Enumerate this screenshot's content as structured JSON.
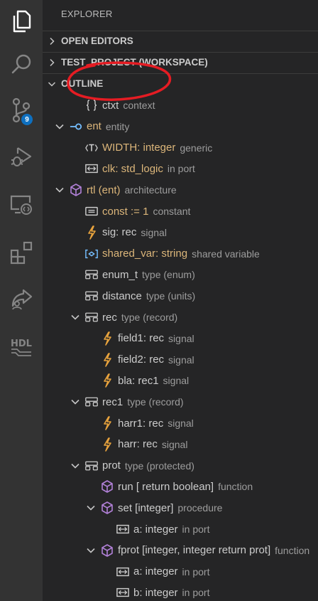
{
  "sidebar": {
    "title": "EXPLORER",
    "sections": [
      {
        "label": "OPEN EDITORS",
        "expanded": false
      },
      {
        "label": "TEST_PROJECT (WORKSPACE)",
        "expanded": false
      },
      {
        "label": "OUTLINE",
        "expanded": true
      }
    ]
  },
  "activity_bar": {
    "items": [
      {
        "icon": "files-icon"
      },
      {
        "icon": "search-icon"
      },
      {
        "icon": "source-control-icon",
        "badge": "9"
      },
      {
        "icon": "run-debug-icon"
      },
      {
        "icon": "remote-explorer-icon"
      },
      {
        "icon": "extensions-icon"
      },
      {
        "icon": "live-share-icon"
      },
      {
        "icon": "hdl-icon",
        "text": "HDL"
      }
    ]
  },
  "outline": [
    {
      "label": "ctxt",
      "desc": "context",
      "icon": "braces-icon",
      "depth": 1,
      "twisty": "none",
      "color": "normal"
    },
    {
      "label": "ent",
      "desc": "entity",
      "icon": "entity-icon",
      "depth": 0,
      "twisty": "open",
      "color": "yellow"
    },
    {
      "label": "WIDTH: integer",
      "desc": "generic",
      "icon": "type-param-icon",
      "depth": 1,
      "twisty": "none",
      "color": "yellow"
    },
    {
      "label": "clk: std_logic",
      "desc": "in port",
      "icon": "port-icon",
      "depth": 1,
      "twisty": "none",
      "color": "yellow"
    },
    {
      "label": "rtl (ent)",
      "desc": "architecture",
      "icon": "cube-icon",
      "depth": 0,
      "twisty": "open",
      "color": "yellow"
    },
    {
      "label": "const := 1",
      "desc": "constant",
      "icon": "constant-icon",
      "depth": 1,
      "twisty": "none",
      "color": "yellow"
    },
    {
      "label": "sig: rec",
      "desc": "signal",
      "icon": "signal-icon",
      "depth": 1,
      "twisty": "none",
      "color": "normal"
    },
    {
      "label": "shared_var: string",
      "desc": "shared variable",
      "icon": "variable-icon",
      "depth": 1,
      "twisty": "none",
      "color": "yellow"
    },
    {
      "label": "enum_t",
      "desc": "type (enum)",
      "icon": "struct-icon",
      "depth": 1,
      "twisty": "none",
      "color": "normal"
    },
    {
      "label": "distance",
      "desc": "type (units)",
      "icon": "struct-icon",
      "depth": 1,
      "twisty": "none",
      "color": "normal"
    },
    {
      "label": "rec",
      "desc": "type (record)",
      "icon": "struct-icon",
      "depth": 1,
      "twisty": "open",
      "color": "normal"
    },
    {
      "label": "field1: rec",
      "desc": "signal",
      "icon": "signal-icon",
      "depth": 2,
      "twisty": "none",
      "color": "normal"
    },
    {
      "label": "field2: rec",
      "desc": "signal",
      "icon": "signal-icon",
      "depth": 2,
      "twisty": "none",
      "color": "normal"
    },
    {
      "label": "bla: rec1",
      "desc": "signal",
      "icon": "signal-icon",
      "depth": 2,
      "twisty": "none",
      "color": "normal"
    },
    {
      "label": "rec1",
      "desc": "type (record)",
      "icon": "struct-icon",
      "depth": 1,
      "twisty": "open",
      "color": "normal"
    },
    {
      "label": "harr1: rec",
      "desc": "signal",
      "icon": "signal-icon",
      "depth": 2,
      "twisty": "none",
      "color": "normal"
    },
    {
      "label": "harr: rec",
      "desc": "signal",
      "icon": "signal-icon",
      "depth": 2,
      "twisty": "none",
      "color": "normal"
    },
    {
      "label": "prot",
      "desc": "type (protected)",
      "icon": "struct-icon",
      "depth": 1,
      "twisty": "open",
      "color": "normal"
    },
    {
      "label": "run [ return boolean]",
      "desc": "function",
      "icon": "method-icon",
      "depth": 2,
      "twisty": "none",
      "color": "normal"
    },
    {
      "label": "set [integer]",
      "desc": "procedure",
      "icon": "method-icon",
      "depth": 2,
      "twisty": "open",
      "color": "normal"
    },
    {
      "label": "a: integer",
      "desc": "in port",
      "icon": "port-icon",
      "depth": 3,
      "twisty": "none",
      "color": "normal"
    },
    {
      "label": "fprot [integer, integer return prot]",
      "desc": "function",
      "icon": "method-icon",
      "depth": 2,
      "twisty": "open",
      "color": "normal"
    },
    {
      "label": "a: integer",
      "desc": "in port",
      "icon": "port-icon",
      "depth": 3,
      "twisty": "none",
      "color": "normal"
    },
    {
      "label": "b: integer",
      "desc": "in port",
      "icon": "port-icon",
      "depth": 3,
      "twisty": "none",
      "color": "normal"
    }
  ],
  "colors": {
    "activity_bg": "#333333",
    "sidebar_bg": "#252526",
    "annotation": "#e51c23",
    "badge": "#0e70c0",
    "signal": "#e8a33d",
    "purple": "#b180d7",
    "blue": "#75beff"
  }
}
